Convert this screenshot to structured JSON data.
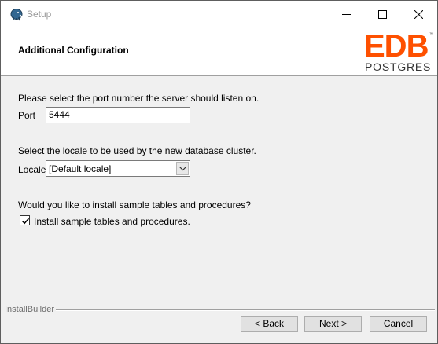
{
  "window": {
    "title": "Setup",
    "icon": "elephant-icon",
    "controls": [
      "minimize-icon",
      "maximize-icon",
      "close-icon"
    ]
  },
  "header": {
    "page_title": "Additional Configuration",
    "logo": {
      "main": "EDB",
      "sub": "POSTGRES",
      "trademark": "™"
    }
  },
  "port_section": {
    "prompt": "Please select the port number the server should listen on.",
    "label": "Port",
    "value": "5444"
  },
  "locale_section": {
    "prompt": "Select the locale to be used by the new database cluster.",
    "label": "Locale",
    "selected": "[Default locale]"
  },
  "samples_section": {
    "prompt": "Would you like to install sample tables and procedures?",
    "checkbox_label": "Install sample tables and procedures.",
    "checked": true
  },
  "footer": {
    "brand": "InstallBuilder",
    "back_label": "< Back",
    "next_label": "Next >",
    "cancel_label": "Cancel"
  },
  "colors": {
    "logo_accent": "#fe5000",
    "dialog_bg": "#f0f0f0",
    "button_bg": "#e1e1e1"
  }
}
